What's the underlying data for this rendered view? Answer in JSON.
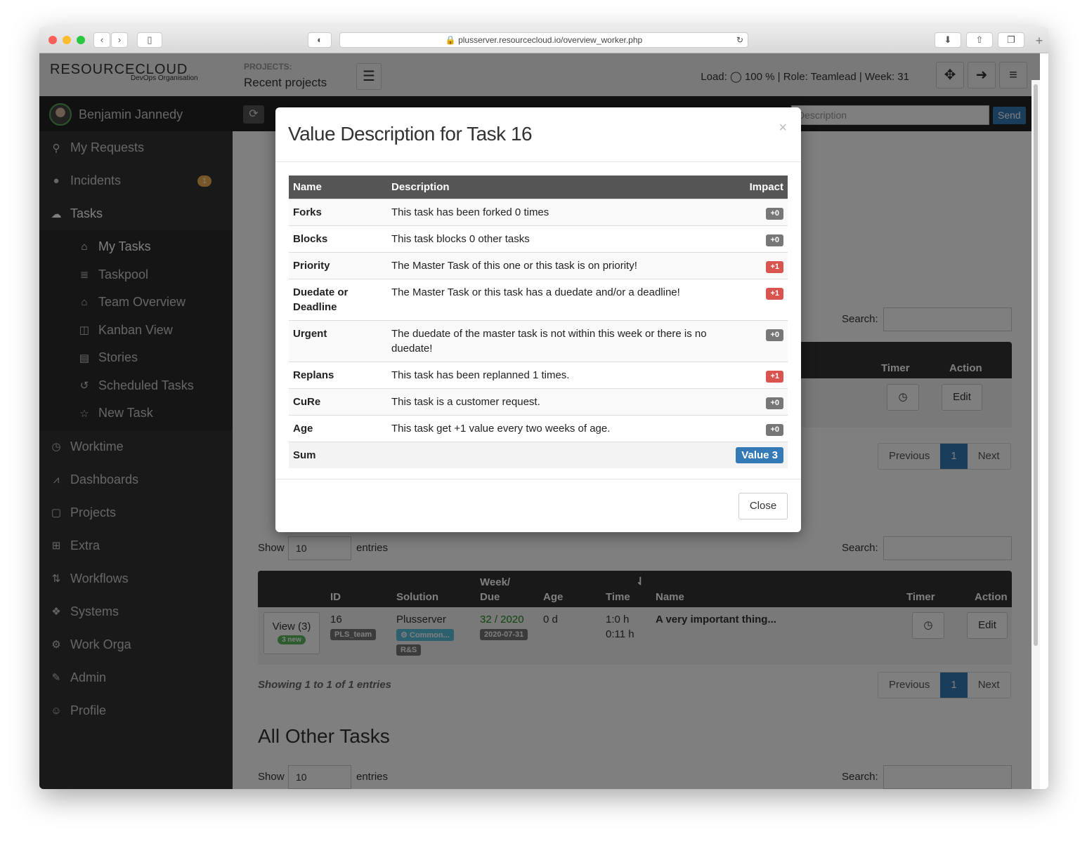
{
  "browser": {
    "url": "plusserver.resourcecloud.io/overview_worker.php"
  },
  "header": {
    "logo": "RESOURCECLOUD",
    "org": "DevOps Organisation",
    "projects_label": "PROJECTS:",
    "projects_select": "Recent projects",
    "load_text": "Load:",
    "status": "100 % | Role: Teamlead | Week: 31"
  },
  "user": {
    "name": "Benjamin Jannedy"
  },
  "quick": {
    "placeholder": "Description",
    "send": "Send"
  },
  "sidebar": {
    "items": [
      {
        "label": "My Requests",
        "icon": "bike"
      },
      {
        "label": "Incidents",
        "icon": "bomb",
        "badge": "1"
      },
      {
        "label": "Tasks",
        "icon": "cloud"
      }
    ],
    "sub": [
      {
        "label": "My Tasks",
        "icon": "home"
      },
      {
        "label": "Taskpool",
        "icon": "database"
      },
      {
        "label": "Team Overview",
        "icon": "home"
      },
      {
        "label": "Kanban View",
        "icon": "columns"
      },
      {
        "label": "Stories",
        "icon": "list"
      },
      {
        "label": "Scheduled Tasks",
        "icon": "history"
      },
      {
        "label": "New Task",
        "icon": "star"
      }
    ],
    "bottom": [
      {
        "label": "Worktime",
        "icon": "clock"
      },
      {
        "label": "Dashboards",
        "icon": "chart"
      },
      {
        "label": "Projects",
        "icon": "briefcase"
      },
      {
        "label": "Extra",
        "icon": "plus-square"
      },
      {
        "label": "Workflows",
        "icon": "sort"
      },
      {
        "label": "Systems",
        "icon": "cubes"
      },
      {
        "label": "Work Orga",
        "icon": "cogs"
      },
      {
        "label": "Admin",
        "icon": "wrench"
      },
      {
        "label": "Profile",
        "icon": "user"
      }
    ]
  },
  "main": {
    "show": "Show",
    "entries": "entries",
    "search": "Search:",
    "page_len": "10",
    "timer": "Timer",
    "action": "Action",
    "previous": "Previous",
    "page": "1",
    "next": "Next",
    "edit": "Edit",
    "cols": {
      "id": "ID",
      "solution": "Solution",
      "week": "Week/",
      "due": "Due",
      "age": "Age",
      "time": "Time",
      "name": "Name"
    },
    "row": {
      "view": "View (3)",
      "new": "3 new",
      "id": "16",
      "team": "PLS_team",
      "solution": "Plusserver",
      "tag1": "Common...",
      "tag2": "R&S",
      "week": "32 / 2020",
      "due": "2020-07-31",
      "age": "0 d",
      "time1": "1:0 h",
      "time2": "0:11 h",
      "name": "A very important thing..."
    },
    "showing": "Showing 1 to 1 of 1 entries",
    "section3": "All Other Tasks"
  },
  "modal": {
    "title": "Value Description for Task 16",
    "close_x": "×",
    "close": "Close",
    "headers": [
      "Name",
      "Description",
      "Impact"
    ],
    "rows": [
      {
        "name": "Forks",
        "desc": "This task has been forked 0 times",
        "impact": "+0"
      },
      {
        "name": "Blocks",
        "desc": "This task blocks 0 other tasks",
        "impact": "+0"
      },
      {
        "name": "Priority",
        "desc": "The Master Task of this one or this task is on priority!",
        "impact": "+1"
      },
      {
        "name": "Duedate or Deadline",
        "desc": "The Master Task or this task has a duedate and/or a deadline!",
        "impact": "+1"
      },
      {
        "name": "Urgent",
        "desc": "The duedate of the master task is not within this week or there is no duedate!",
        "impact": "+0"
      },
      {
        "name": "Replans",
        "desc": "This task has been replanned 1 times.",
        "impact": "+1"
      },
      {
        "name": "CuRe",
        "desc": "This task is a customer request.",
        "impact": "+0"
      },
      {
        "name": "Age",
        "desc": "This task get +1 value every two weeks of age.",
        "impact": "+0"
      }
    ],
    "sum_label": "Sum",
    "sum_value": "Value 3"
  },
  "colors": {
    "positive": "#d9534f",
    "neutral": "#777777",
    "primary": "#337ab7"
  }
}
